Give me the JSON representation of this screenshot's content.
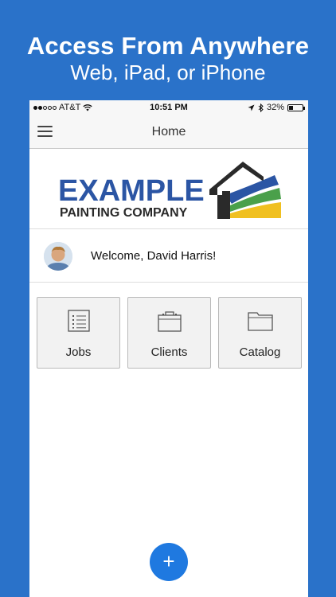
{
  "promo": {
    "title": "Access From Anywhere",
    "subtitle": "Web, iPad, or iPhone"
  },
  "status_bar": {
    "carrier": "AT&T",
    "time": "10:51 PM",
    "battery": "32%",
    "battery_level": 0.32,
    "signal_bars_filled": 2,
    "signal_bars_total": 5
  },
  "nav": {
    "title": "Home",
    "menu_icon": "hamburger-menu-icon"
  },
  "logo": {
    "line1": "EXAMPLE",
    "line2": "PAINTING COMPANY",
    "colors": {
      "text_blue": "#2b55a4",
      "text_dark": "#2a2a2a",
      "house": "#2a2a2a",
      "stripe_blue": "#2b55a4",
      "stripe_green": "#4aa04a",
      "stripe_yellow": "#f0c020"
    }
  },
  "welcome": {
    "text": "Welcome, David Harris!"
  },
  "tiles": [
    {
      "label": "Jobs",
      "icon": "list-icon"
    },
    {
      "label": "Clients",
      "icon": "briefcase-icon"
    },
    {
      "label": "Catalog",
      "icon": "folder-icon"
    }
  ],
  "fab": {
    "label": "+",
    "icon": "plus-icon"
  },
  "colors": {
    "background": "#2a72c9",
    "fab": "#1f79e0"
  }
}
